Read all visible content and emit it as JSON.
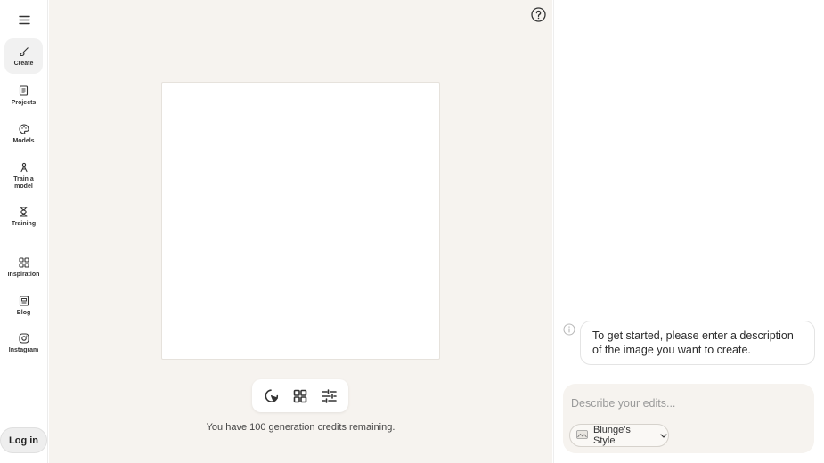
{
  "sidebar": {
    "items": [
      {
        "id": "create",
        "label": "Create",
        "icon": "brush-icon",
        "active": true
      },
      {
        "id": "projects",
        "label": "Projects",
        "icon": "document-icon"
      },
      {
        "id": "models",
        "label": "Models",
        "icon": "palette-icon"
      },
      {
        "id": "train",
        "label": "Train a model",
        "label_line1": "Train a",
        "label_line2": "model",
        "icon": "train-icon"
      },
      {
        "id": "training",
        "label": "Training",
        "icon": "hourglass-icon"
      },
      {
        "id": "inspiration",
        "label": "Inspiration",
        "icon": "grid-icon"
      },
      {
        "id": "blog",
        "label": "Blog",
        "icon": "newspaper-icon"
      },
      {
        "id": "instagram",
        "label": "Instagram",
        "icon": "instagram-icon"
      }
    ],
    "login_label": "Log in"
  },
  "main": {
    "credits_text": "You have 100 generation credits remaining.",
    "toolbar": [
      "select-tool-icon",
      "gallery-grid-icon",
      "adjustments-icon"
    ]
  },
  "assistant": {
    "message": "To get started, please enter a description of the image you want to create.",
    "prompt_placeholder": "Describe your edits...",
    "prompt_value": "",
    "style_label": "Blunge's Style"
  },
  "colors": {
    "main_bg": "#f6f3ef",
    "panel_bg": "#ffffff",
    "text": "#1f1f1f"
  }
}
